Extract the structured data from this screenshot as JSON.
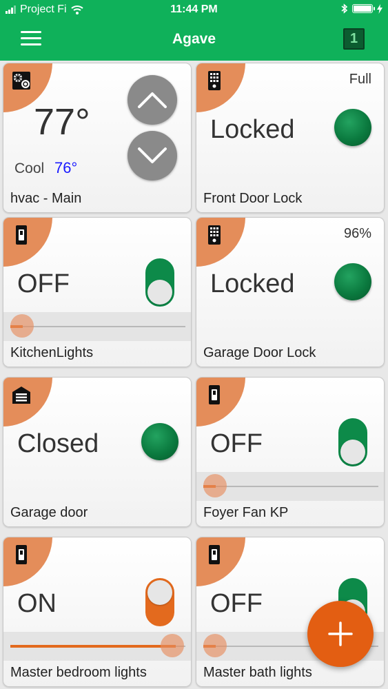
{
  "status_bar": {
    "carrier": "Project Fi",
    "time": "11:44 PM"
  },
  "app_bar": {
    "title": "Agave",
    "badge": "1"
  },
  "tiles": {
    "hvac": {
      "name": "hvac - Main",
      "temperature": "77°",
      "mode": "Cool",
      "setpoint": "76°",
      "icon": "hvac-icon"
    },
    "front_door_lock": {
      "name": "Front Door Lock",
      "state": "Locked",
      "battery": "Full",
      "icon": "keypad-lock-icon"
    },
    "kitchen_lights": {
      "name": "KitchenLights",
      "state": "OFF",
      "dim_level": 0,
      "icon": "light-switch-icon"
    },
    "garage_door_lock": {
      "name": "Garage Door Lock",
      "state": "Locked",
      "battery": "96%",
      "icon": "keypad-lock-icon"
    },
    "garage_door": {
      "name": "Garage door",
      "state": "Closed",
      "icon": "garage-icon"
    },
    "foyer_fan": {
      "name": "Foyer Fan KP",
      "state": "OFF",
      "dim_level": 0,
      "icon": "light-switch-icon"
    },
    "master_bedroom_lights": {
      "name": "Master bedroom lights",
      "state": "ON",
      "dim_level": 1.0,
      "icon": "light-switch-icon"
    },
    "master_bath_lights": {
      "name": "Master bath lights",
      "state": "OFF",
      "dim_level": 0,
      "icon": "light-switch-icon"
    }
  },
  "colors": {
    "brand_green": "#0fb15a",
    "accent_orange": "#e36a1e",
    "tile_corner": "#e48d5a",
    "setpoint_blue": "#1a1aff"
  }
}
